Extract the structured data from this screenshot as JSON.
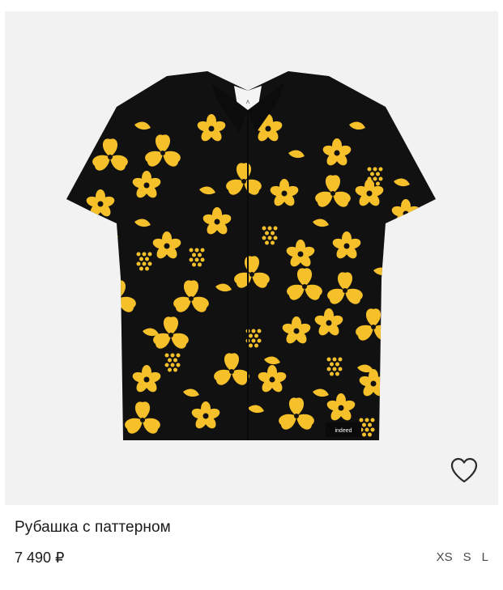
{
  "product": {
    "title": "Рубашка с паттерном",
    "price": "7 490 ₽",
    "sizes": [
      "XS",
      "S",
      "L"
    ],
    "image_alt": "Black short-sleeve shirt with yellow floral pattern",
    "label_text": "indeed"
  },
  "icons": {
    "wishlist": "heart-outline-icon"
  },
  "colors": {
    "image_background": "#f2f2f2",
    "shirt_base": "#111111",
    "pattern": "#f5c02a"
  }
}
